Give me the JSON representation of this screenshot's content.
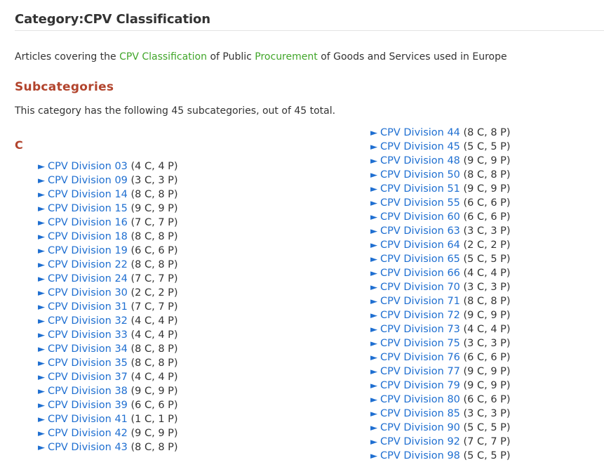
{
  "page": {
    "title": "Category:CPV Classification",
    "intro": {
      "prefix": "Articles covering the ",
      "link1": "CPV Classification",
      "middle": " of Public ",
      "link2": "Procurement",
      "suffix": " of Goods and Services used in Europe"
    },
    "subcategories_heading": "Subcategories",
    "count_text": "This category has the following 45 subcategories, out of 45 total.",
    "letter": "C",
    "arrow": "►"
  },
  "columns": [
    [
      {
        "label": "CPV Division 03",
        "meta": "(4 C, 4 P)"
      },
      {
        "label": "CPV Division 09",
        "meta": "(3 C, 3 P)"
      },
      {
        "label": "CPV Division 14",
        "meta": "(8 C, 8 P)"
      },
      {
        "label": "CPV Division 15",
        "meta": "(9 C, 9 P)"
      },
      {
        "label": "CPV Division 16",
        "meta": "(7 C, 7 P)"
      },
      {
        "label": "CPV Division 18",
        "meta": "(8 C, 8 P)"
      },
      {
        "label": "CPV Division 19",
        "meta": "(6 C, 6 P)"
      },
      {
        "label": "CPV Division 22",
        "meta": "(8 C, 8 P)"
      },
      {
        "label": "CPV Division 24",
        "meta": "(7 C, 7 P)"
      },
      {
        "label": "CPV Division 30",
        "meta": "(2 C, 2 P)"
      },
      {
        "label": "CPV Division 31",
        "meta": "(7 C, 7 P)"
      },
      {
        "label": "CPV Division 32",
        "meta": "(4 C, 4 P)"
      },
      {
        "label": "CPV Division 33",
        "meta": "(4 C, 4 P)"
      },
      {
        "label": "CPV Division 34",
        "meta": "(8 C, 8 P)"
      },
      {
        "label": "CPV Division 35",
        "meta": "(8 C, 8 P)"
      },
      {
        "label": "CPV Division 37",
        "meta": "(4 C, 4 P)"
      },
      {
        "label": "CPV Division 38",
        "meta": "(9 C, 9 P)"
      },
      {
        "label": "CPV Division 39",
        "meta": "(6 C, 6 P)"
      },
      {
        "label": "CPV Division 41",
        "meta": "(1 C, 1 P)"
      },
      {
        "label": "CPV Division 42",
        "meta": "(9 C, 9 P)"
      },
      {
        "label": "CPV Division 43",
        "meta": "(8 C, 8 P)"
      }
    ],
    [
      {
        "label": "CPV Division 44",
        "meta": "(8 C, 8 P)"
      },
      {
        "label": "CPV Division 45",
        "meta": "(5 C, 5 P)"
      },
      {
        "label": "CPV Division 48",
        "meta": "(9 C, 9 P)"
      },
      {
        "label": "CPV Division 50",
        "meta": "(8 C, 8 P)"
      },
      {
        "label": "CPV Division 51",
        "meta": "(9 C, 9 P)"
      },
      {
        "label": "CPV Division 55",
        "meta": "(6 C, 6 P)"
      },
      {
        "label": "CPV Division 60",
        "meta": "(6 C, 6 P)"
      },
      {
        "label": "CPV Division 63",
        "meta": "(3 C, 3 P)"
      },
      {
        "label": "CPV Division 64",
        "meta": "(2 C, 2 P)"
      },
      {
        "label": "CPV Division 65",
        "meta": "(5 C, 5 P)"
      },
      {
        "label": "CPV Division 66",
        "meta": "(4 C, 4 P)"
      },
      {
        "label": "CPV Division 70",
        "meta": "(3 C, 3 P)"
      },
      {
        "label": "CPV Division 71",
        "meta": "(8 C, 8 P)"
      },
      {
        "label": "CPV Division 72",
        "meta": "(9 C, 9 P)"
      },
      {
        "label": "CPV Division 73",
        "meta": "(4 C, 4 P)"
      },
      {
        "label": "CPV Division 75",
        "meta": "(3 C, 3 P)"
      },
      {
        "label": "CPV Division 76",
        "meta": "(6 C, 6 P)"
      },
      {
        "label": "CPV Division 77",
        "meta": "(9 C, 9 P)"
      },
      {
        "label": "CPV Division 79",
        "meta": "(9 C, 9 P)"
      },
      {
        "label": "CPV Division 80",
        "meta": "(6 C, 6 P)"
      },
      {
        "label": "CPV Division 85",
        "meta": "(3 C, 3 P)"
      },
      {
        "label": "CPV Division 90",
        "meta": "(5 C, 5 P)"
      },
      {
        "label": "CPV Division 92",
        "meta": "(7 C, 7 P)"
      },
      {
        "label": "CPV Division 98",
        "meta": "(5 C, 5 P)"
      }
    ]
  ],
  "colors": {
    "link": "#1f6fd1",
    "green_link": "#41a62a",
    "heading": "#b2442d",
    "text": "#333333",
    "expand_arrow_icon": "triangle-right-icon"
  }
}
